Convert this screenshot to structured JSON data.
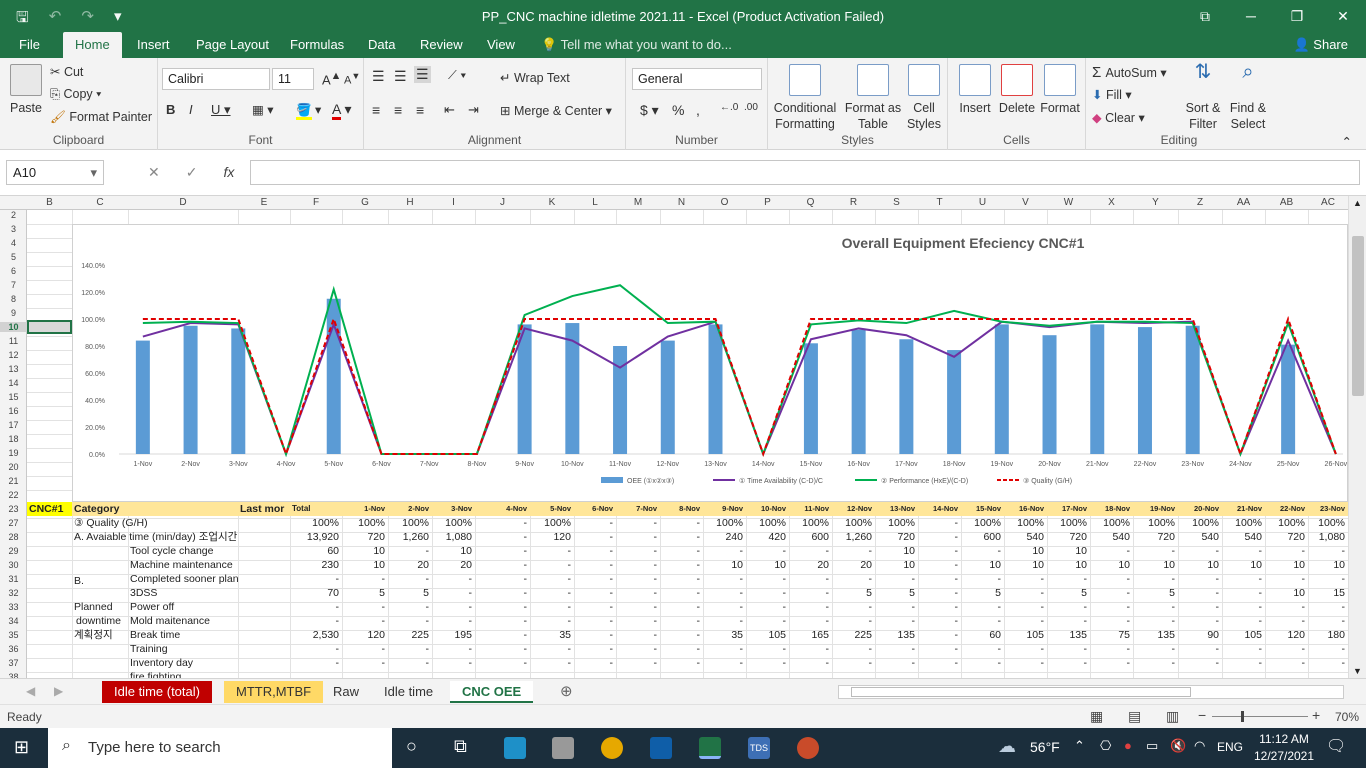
{
  "window": {
    "title": "PP_CNC machine idletime 2021.11 - Excel (Product Activation Failed)"
  },
  "tabs": [
    "File",
    "Home",
    "Insert",
    "Page Layout",
    "Formulas",
    "Data",
    "Review",
    "View"
  ],
  "tell_me": "Tell me what you want to do...",
  "share": "Share",
  "clipboard": {
    "paste": "Paste",
    "cut": "Cut",
    "copy": "Copy",
    "format_painter": "Format Painter",
    "label": "Clipboard"
  },
  "font": {
    "name": "Calibri",
    "size": "11",
    "label": "Font"
  },
  "alignment": {
    "wrap": "Wrap Text",
    "merge": "Merge & Center",
    "label": "Alignment"
  },
  "number": {
    "format": "General",
    "label": "Number"
  },
  "styles": {
    "cond": "Conditional Formatting",
    "table": "Format as Table",
    "cell": "Cell Styles",
    "label": "Styles"
  },
  "cells": {
    "insert": "Insert",
    "delete": "Delete",
    "format": "Format",
    "label": "Cells"
  },
  "editing": {
    "autosum": "AutoSum",
    "fill": "Fill",
    "clear": "Clear",
    "sort": "Sort & Filter",
    "find": "Find & Select",
    "label": "Editing"
  },
  "namebox": "A10",
  "columns": [
    "B",
    "C",
    "D",
    "E",
    "F",
    "G",
    "H",
    "I",
    "J",
    "K",
    "L",
    "M",
    "N",
    "O",
    "P",
    "Q",
    "R",
    "S",
    "T",
    "U",
    "V",
    "W",
    "X",
    "Y",
    "Z",
    "AA",
    "AB",
    "AC"
  ],
  "rows": [
    "2",
    "3",
    "4",
    "5",
    "6",
    "7",
    "8",
    "9",
    "10",
    "11",
    "12",
    "13",
    "14",
    "15",
    "16",
    "17",
    "18",
    "19",
    "20",
    "21",
    "22",
    "23",
    "27",
    "28",
    "29",
    "30",
    "31",
    "32",
    "33",
    "34",
    "35",
    "36",
    "37",
    "38"
  ],
  "chart_data": {
    "type": "bar",
    "title": "Overall Equipment Efeciency CNC#1",
    "categories": [
      "1-Nov",
      "2-Nov",
      "3-Nov",
      "4-Nov",
      "5-Nov",
      "6-Nov",
      "7-Nov",
      "8-Nov",
      "9-Nov",
      "10-Nov",
      "11-Nov",
      "12-Nov",
      "13-Nov",
      "14-Nov",
      "15-Nov",
      "16-Nov",
      "17-Nov",
      "18-Nov",
      "19-Nov",
      "20-Nov",
      "21-Nov",
      "22-Nov",
      "23-Nov",
      "24-Nov",
      "25-Nov",
      "26-Nov"
    ],
    "y_ticks": [
      "0.0%",
      "20.0%",
      "40.0%",
      "60.0%",
      "80.0%",
      "100.0%",
      "120.0%",
      "140.0%"
    ],
    "ylim": [
      0,
      1.4
    ],
    "series": [
      {
        "name": "OEE (①x②x③)",
        "kind": "bar",
        "color": "#5b9bd5",
        "values": [
          0.84,
          0.95,
          0.93,
          0,
          1.15,
          0,
          0,
          0,
          0.96,
          0.97,
          0.8,
          0.84,
          0.96,
          0,
          0.82,
          0.92,
          0.85,
          0.77,
          0.96,
          0.88,
          0.96,
          0.94,
          0.95,
          0,
          0.81,
          0
        ]
      },
      {
        "name": "① Time Availability (C-D)/C",
        "kind": "line",
        "color": "#7030a0",
        "values": [
          0.87,
          0.97,
          0.96,
          0,
          0.96,
          0,
          0,
          0,
          0.93,
          0.84,
          0.64,
          0.87,
          0.98,
          0,
          0.85,
          0.93,
          0.88,
          0.72,
          0.98,
          0.94,
          0.98,
          0.97,
          0.98,
          0,
          0.84,
          0
        ]
      },
      {
        "name": "② Performance (HxE)/(C-D)",
        "kind": "line",
        "color": "#00b050",
        "values": [
          0.97,
          0.98,
          0.97,
          0,
          1.22,
          0,
          0,
          0,
          1.03,
          1.17,
          1.25,
          0.97,
          0.98,
          0,
          0.96,
          0.99,
          0.97,
          1.06,
          0.98,
          0.95,
          0.98,
          0.98,
          0.97,
          0,
          0.97,
          0
        ]
      },
      {
        "name": "③ Quality (G/H)",
        "kind": "dashed",
        "color": "#e00000",
        "values": [
          1,
          1,
          1,
          0,
          1,
          0,
          0,
          0,
          1,
          1,
          1,
          1,
          1,
          0,
          1,
          1,
          1,
          1,
          1,
          1,
          1,
          1,
          1,
          0,
          1,
          0
        ]
      }
    ]
  },
  "table": {
    "r23": {
      "a": "CNC#1",
      "b": "Category",
      "c": "Last mor",
      "total": "Total",
      "days": [
        "1-Nov",
        "2-Nov",
        "3-Nov",
        "4-Nov",
        "5-Nov",
        "6-Nov",
        "7-Nov",
        "8-Nov",
        "9-Nov",
        "10-Nov",
        "11-Nov",
        "12-Nov",
        "13-Nov",
        "14-Nov",
        "15-Nov",
        "16-Nov",
        "17-Nov",
        "18-Nov",
        "19-Nov",
        "20-Nov",
        "21-Nov",
        "22-Nov",
        "23-Nov"
      ]
    },
    "rows": [
      {
        "label": "③ Quality (G/H)",
        "total": "100%",
        "v": [
          "100%",
          "100%",
          "100%",
          "-",
          "100%",
          "-",
          "-",
          "-",
          "100%",
          "100%",
          "100%",
          "100%",
          "100%",
          "-",
          "100%",
          "100%",
          "100%",
          "100%",
          "100%",
          "100%",
          "100%",
          "100%",
          "100%"
        ]
      },
      {
        "label": "A. Avaiable time (min/day) 조업시간",
        "total": "13,920",
        "v": [
          "720",
          "1,260",
          "1,080",
          "-",
          "120",
          "-",
          "-",
          "-",
          "240",
          "420",
          "600",
          "1,260",
          "720",
          "-",
          "600",
          "540",
          "720",
          "540",
          "720",
          "540",
          "540",
          "720",
          "1,080"
        ]
      },
      {
        "label": "Tool cycle change",
        "total": "60",
        "v": [
          "10",
          "-",
          "10",
          "-",
          "-",
          "-",
          "-",
          "-",
          "-",
          "-",
          "-",
          "-",
          "10",
          "-",
          "-",
          "10",
          "10",
          "-",
          "-",
          "-",
          "-",
          "-",
          "-"
        ]
      },
      {
        "label": "Machine maintenance",
        "total": "230",
        "v": [
          "10",
          "20",
          "20",
          "-",
          "-",
          "-",
          "-",
          "-",
          "10",
          "10",
          "20",
          "20",
          "10",
          "-",
          "10",
          "10",
          "10",
          "10",
          "10",
          "10",
          "10",
          "10",
          "10"
        ]
      },
      {
        "label": "Completed sooner plan",
        "total": "-",
        "v": [
          "-",
          "-",
          "-",
          "-",
          "-",
          "-",
          "-",
          "-",
          "-",
          "-",
          "-",
          "-",
          "-",
          "-",
          "-",
          "-",
          "-",
          "-",
          "-",
          "-",
          "-",
          "-",
          "-"
        ]
      },
      {
        "label": "3DSS",
        "total": "70",
        "v": [
          "5",
          "5",
          "-",
          "-",
          "-",
          "-",
          "-",
          "-",
          "-",
          "-",
          "-",
          "5",
          "5",
          "-",
          "5",
          "-",
          "5",
          "-",
          "5",
          "-",
          "-",
          "10",
          "15"
        ]
      },
      {
        "label": "Power off",
        "total": "-",
        "v": [
          "-",
          "-",
          "-",
          "-",
          "-",
          "-",
          "-",
          "-",
          "-",
          "-",
          "-",
          "-",
          "-",
          "-",
          "-",
          "-",
          "-",
          "-",
          "-",
          "-",
          "-",
          "-",
          "-"
        ]
      },
      {
        "label": "Mold maitenance",
        "total": "-",
        "v": [
          "-",
          "-",
          "-",
          "-",
          "-",
          "-",
          "-",
          "-",
          "-",
          "-",
          "-",
          "-",
          "-",
          "-",
          "-",
          "-",
          "-",
          "-",
          "-",
          "-",
          "-",
          "-",
          "-"
        ]
      },
      {
        "label": "Break time",
        "total": "2,530",
        "v": [
          "120",
          "225",
          "195",
          "-",
          "35",
          "-",
          "-",
          "-",
          "35",
          "105",
          "165",
          "225",
          "135",
          "-",
          "60",
          "105",
          "135",
          "75",
          "135",
          "90",
          "105",
          "120",
          "180"
        ]
      },
      {
        "label": "Training",
        "total": "-",
        "v": [
          "-",
          "-",
          "-",
          "-",
          "-",
          "-",
          "-",
          "-",
          "-",
          "-",
          "-",
          "-",
          "-",
          "-",
          "-",
          "-",
          "-",
          "-",
          "-",
          "-",
          "-",
          "-",
          "-"
        ]
      },
      {
        "label": "Inventory day",
        "total": "-",
        "v": [
          "-",
          "-",
          "-",
          "-",
          "-",
          "-",
          "-",
          "-",
          "-",
          "-",
          "-",
          "-",
          "-",
          "-",
          "-",
          "-",
          "-",
          "-",
          "-",
          "-",
          "-",
          "-",
          "-"
        ]
      },
      {
        "label": "fire fighting",
        "total": "",
        "v": []
      }
    ],
    "group_label_1": "B.",
    "group_label_2": "Planned",
    "group_label_3": "downtime",
    "group_label_4": "계획정지"
  },
  "sheets": [
    "Idle time (total)",
    "MTTR,MTBF",
    "Raw",
    "Idle time",
    "CNC OEE"
  ],
  "status": {
    "ready": "Ready",
    "zoom": "70%"
  },
  "taskbar": {
    "search": "Type here to search",
    "weather": "56°F",
    "lang": "ENG",
    "time": "11:12 AM",
    "date": "12/27/2021"
  }
}
